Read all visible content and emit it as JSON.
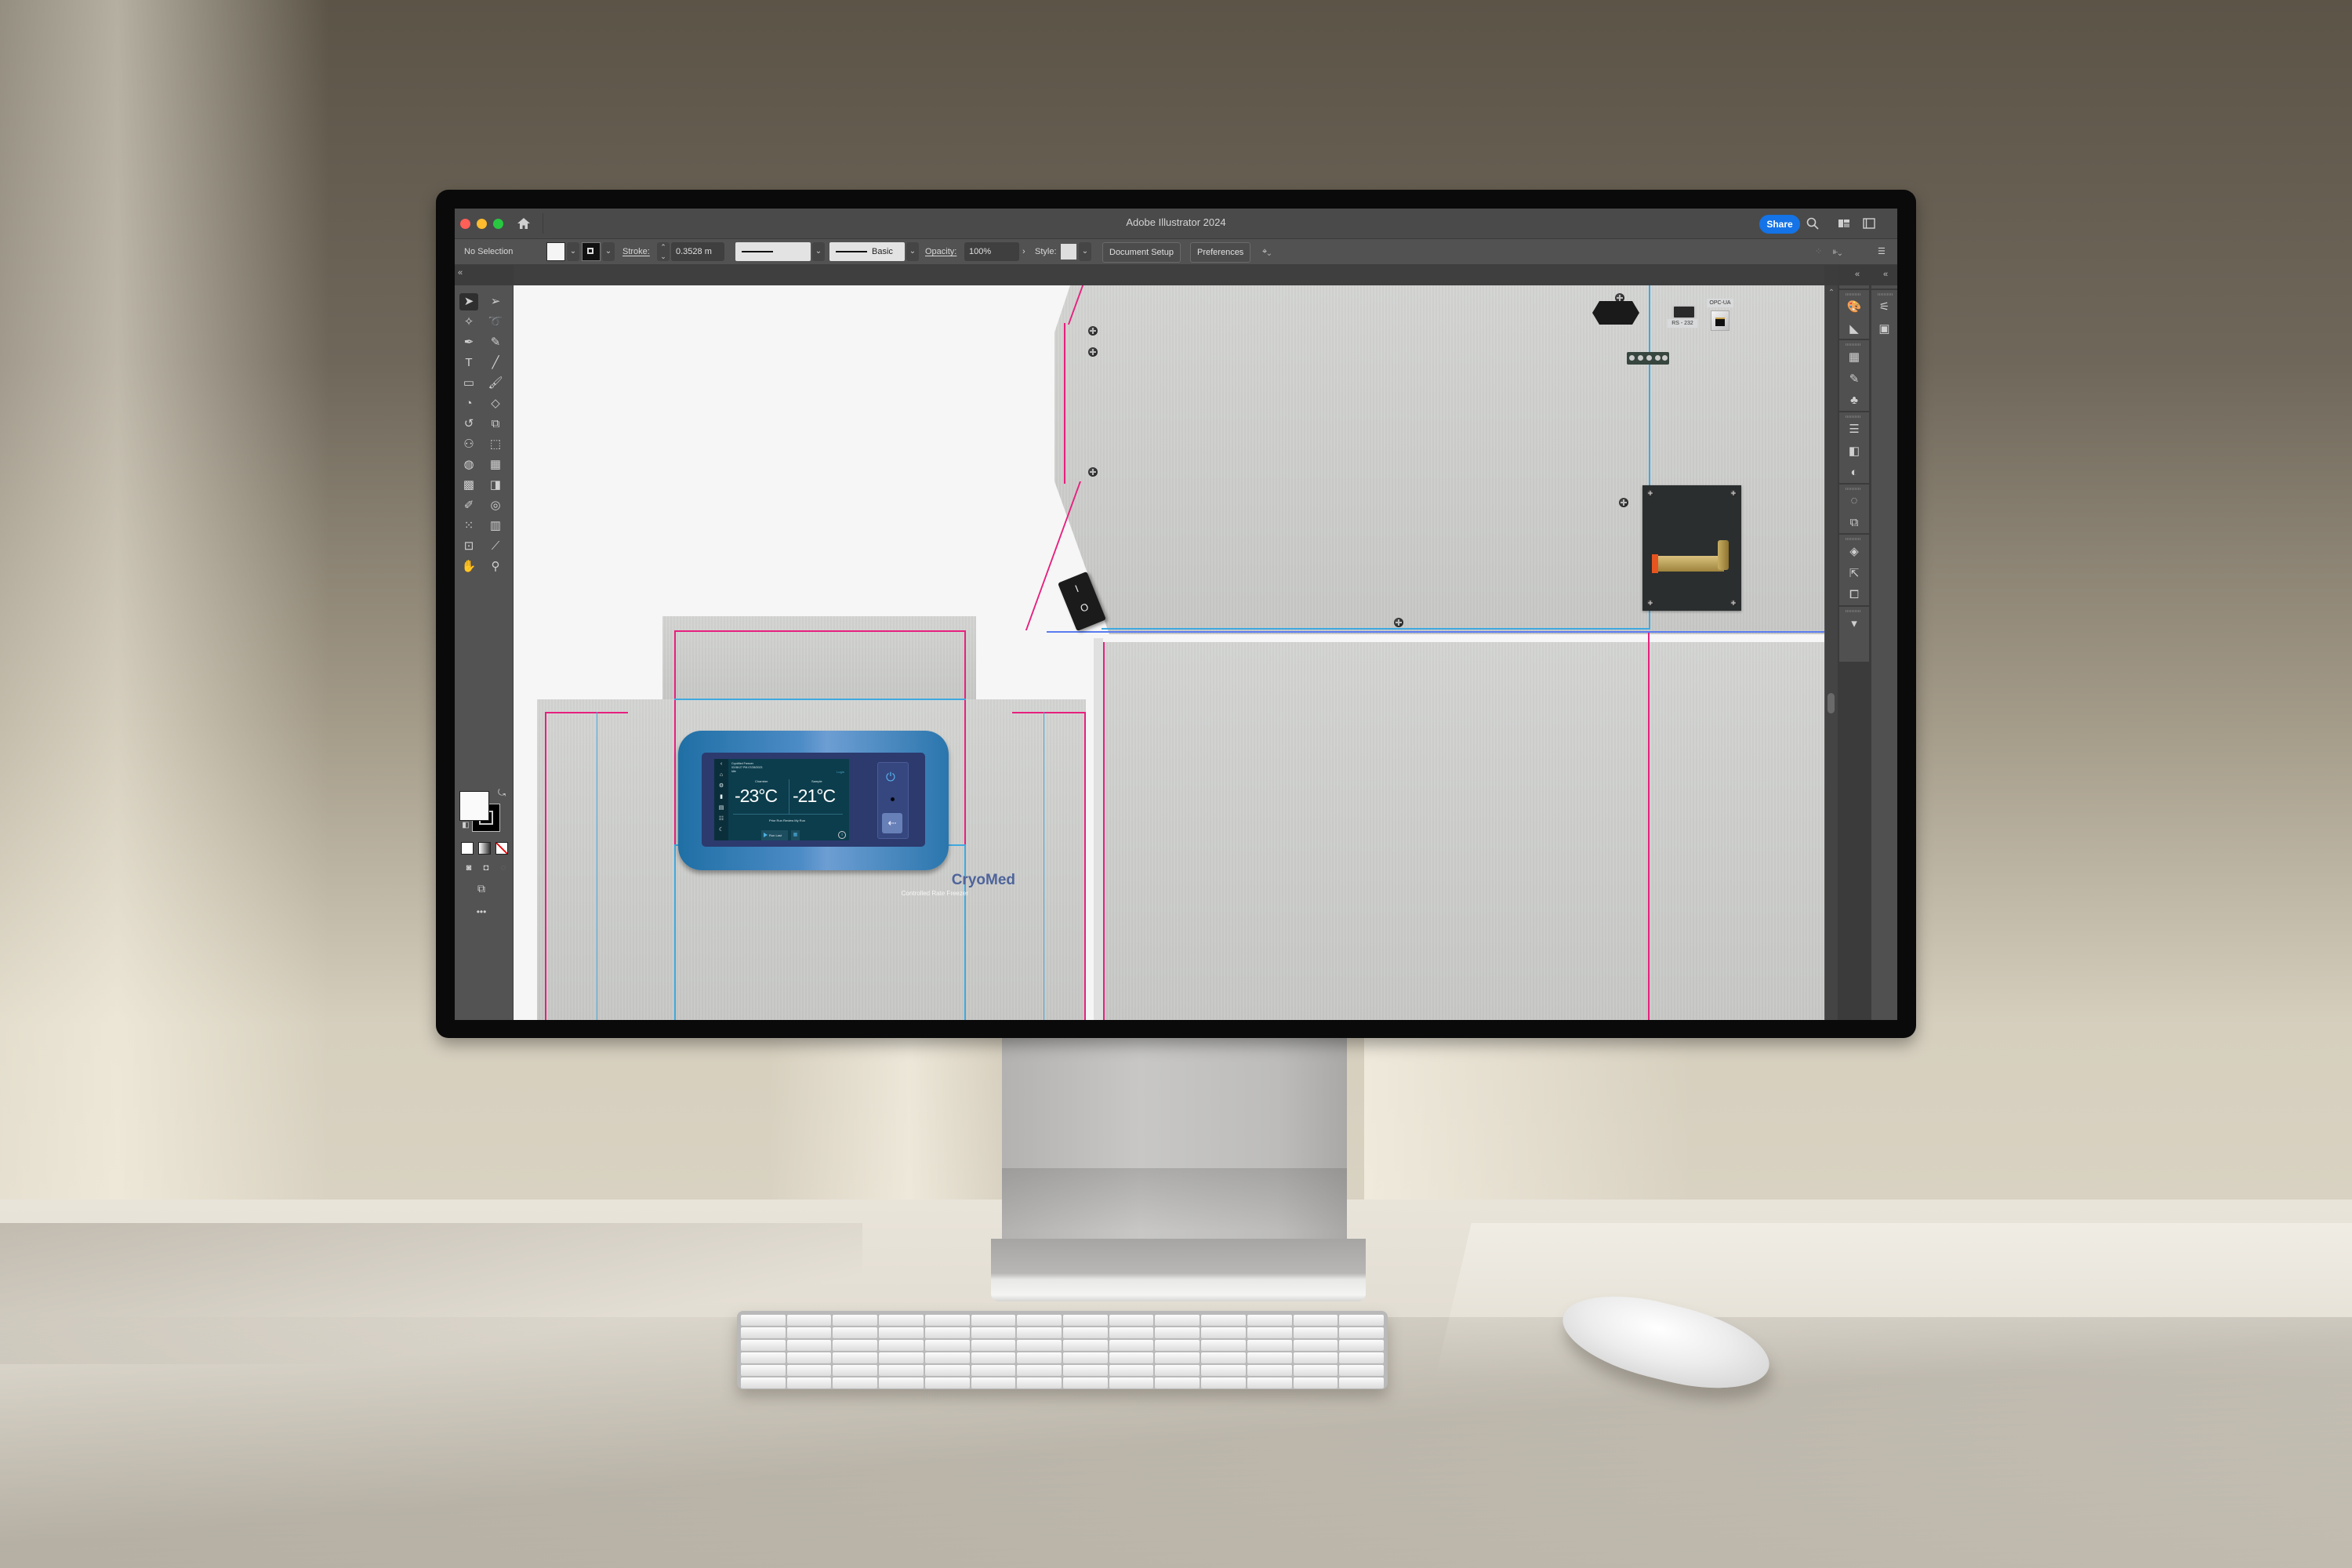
{
  "app": {
    "title": "Adobe Illustrator 2024",
    "share_label": "Share",
    "window_controls": [
      "close",
      "minimize",
      "zoom"
    ],
    "title_icons": [
      "home-icon",
      "search-icon",
      "arrange-documents-icon",
      "workspace-icon"
    ]
  },
  "control_bar": {
    "selection_status": "No Selection",
    "fill_color": "#f5f5f5",
    "stroke_label": "Stroke:",
    "stroke_weight": "0.3528 m",
    "variable_width_profile": "Uniform",
    "brush_definition": "Basic",
    "opacity_label": "Opacity:",
    "opacity_value": "100%",
    "style_label": "Style:",
    "document_setup_label": "Document Setup",
    "preferences_label": "Preferences",
    "right_icons": [
      "align-icon",
      "transform-icon",
      "panel-menu-icon"
    ]
  },
  "toolbar": {
    "tools": [
      "selection-tool",
      "direct-selection-tool",
      "magic-wand-tool",
      "lasso-tool",
      "pen-tool",
      "curvature-tool",
      "type-tool",
      "line-segment-tool",
      "rectangle-tool",
      "paintbrush-tool",
      "shaper-tool",
      "eraser-tool",
      "rotate-tool",
      "scale-tool",
      "puppet-warp-tool",
      "free-transform-tool",
      "shape-builder-tool",
      "perspective-grid-tool",
      "mesh-tool",
      "gradient-tool",
      "eyedropper-tool",
      "blend-tool",
      "symbol-sprayer-tool",
      "column-graph-tool",
      "artboard-tool",
      "slice-tool",
      "hand-tool",
      "zoom-tool"
    ],
    "active_tool": "selection-tool",
    "fill_color": "#fafafa",
    "stroke_color": "#000000",
    "more_label": "•••"
  },
  "right_dock": {
    "column_1": [
      "color-icon",
      "color-guide-icon",
      "swatches-icon",
      "brushes-icon",
      "symbols-icon",
      "stroke-icon",
      "gradient-icon",
      "transparency-icon",
      "appearance-icon",
      "graphic-styles-icon",
      "layers-icon",
      "asset-export-icon",
      "artboards-icon",
      "comments-icon"
    ],
    "column_2": [
      "properties-icon",
      "libraries-icon"
    ]
  },
  "artwork": {
    "brand_name": "CryoMed",
    "brand_subtitle": "Controlled Rate Freezer",
    "brand_color": "#4e649a",
    "guide_colors": {
      "bleed": "#e7207e",
      "fold": "#3fa9e0"
    },
    "display": {
      "device_name": "CryoMed Freezer",
      "timestamp": "03:58:27 PM   07/28/2023",
      "status": "Idle",
      "login_label": "Login",
      "chamber_label": "Chamber",
      "chamber_temp": "-23°C",
      "sample_label": "Sample",
      "sample_temp": "-21°C",
      "tabs": "Prior Run Review   My Run",
      "run_last_label": "Run Last",
      "side_nav": [
        "back",
        "home",
        "settings",
        "document",
        "runs",
        "users",
        "sleep"
      ]
    },
    "rear_panel": {
      "rocker_on": "I",
      "rocker_off": "O",
      "serial_port_label": "RS - 232",
      "network_port_label": "OPC-UA"
    }
  }
}
